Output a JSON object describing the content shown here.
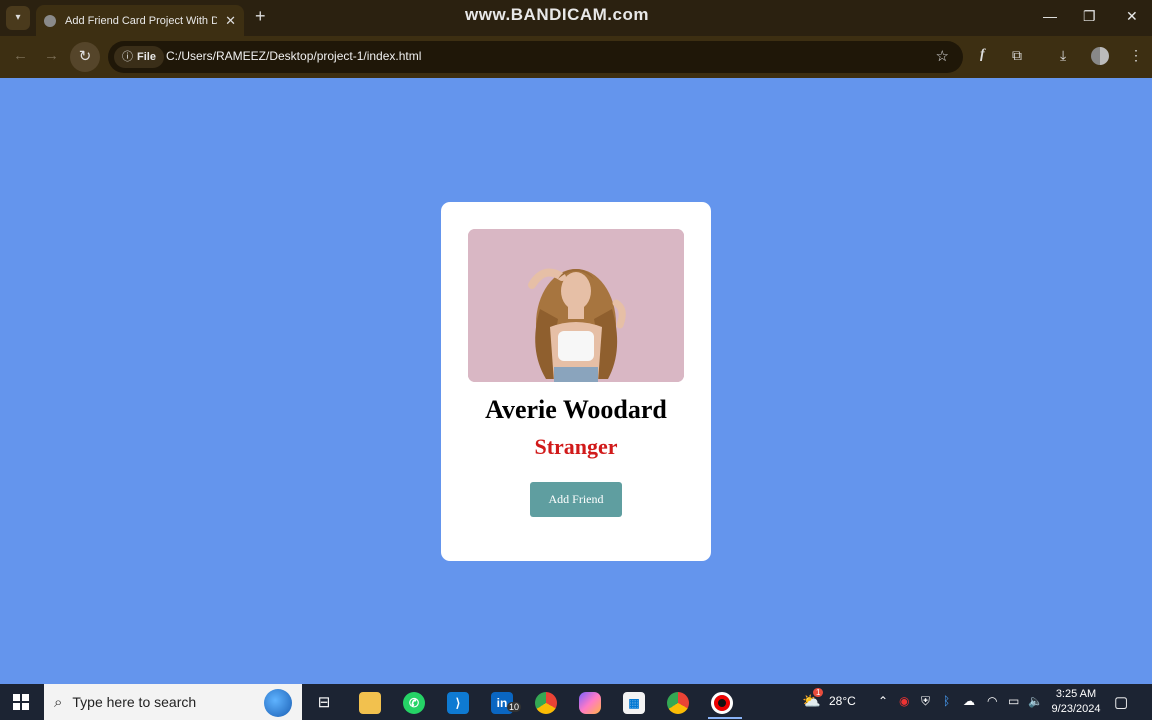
{
  "browser": {
    "tab_title": "Add Friend Card Project With D",
    "tab_close": "✕",
    "new_tab": "+",
    "watermark": "www.BANDICAM.com",
    "window_controls": [
      "—",
      "❐",
      "✕"
    ],
    "omnibox_chip": "File",
    "url": "C:/Users/RAMEEZ/Desktop/project-1/index.html"
  },
  "card": {
    "name": "Averie Woodard",
    "status": "Stranger",
    "button_label": "Add Friend",
    "status_color": "#d11a1a",
    "button_color": "#5f9ea0"
  },
  "page": {
    "background": "#6495ED"
  },
  "taskbar": {
    "search_placeholder": "Type here to search",
    "temperature": "28°C",
    "time": "3:25 AM",
    "date": "9/23/2024",
    "linkedin_badge": "10",
    "weather_badge": "1"
  },
  "icons": [
    "tab-menu-icon",
    "favicon-icon",
    "back-icon",
    "forward-icon",
    "reload-icon",
    "info-icon",
    "star-icon",
    "font-icon",
    "extensions-icon",
    "download-icon",
    "profile-icon",
    "menu-icon",
    "windows-start-icon",
    "search-icon",
    "task-view-icon",
    "file-explorer-icon",
    "whatsapp-icon",
    "vscode-icon",
    "linkedin-icon",
    "chrome-icon",
    "copilot-icon",
    "store-icon",
    "record-icon",
    "weather-icon",
    "notification-icon"
  ]
}
